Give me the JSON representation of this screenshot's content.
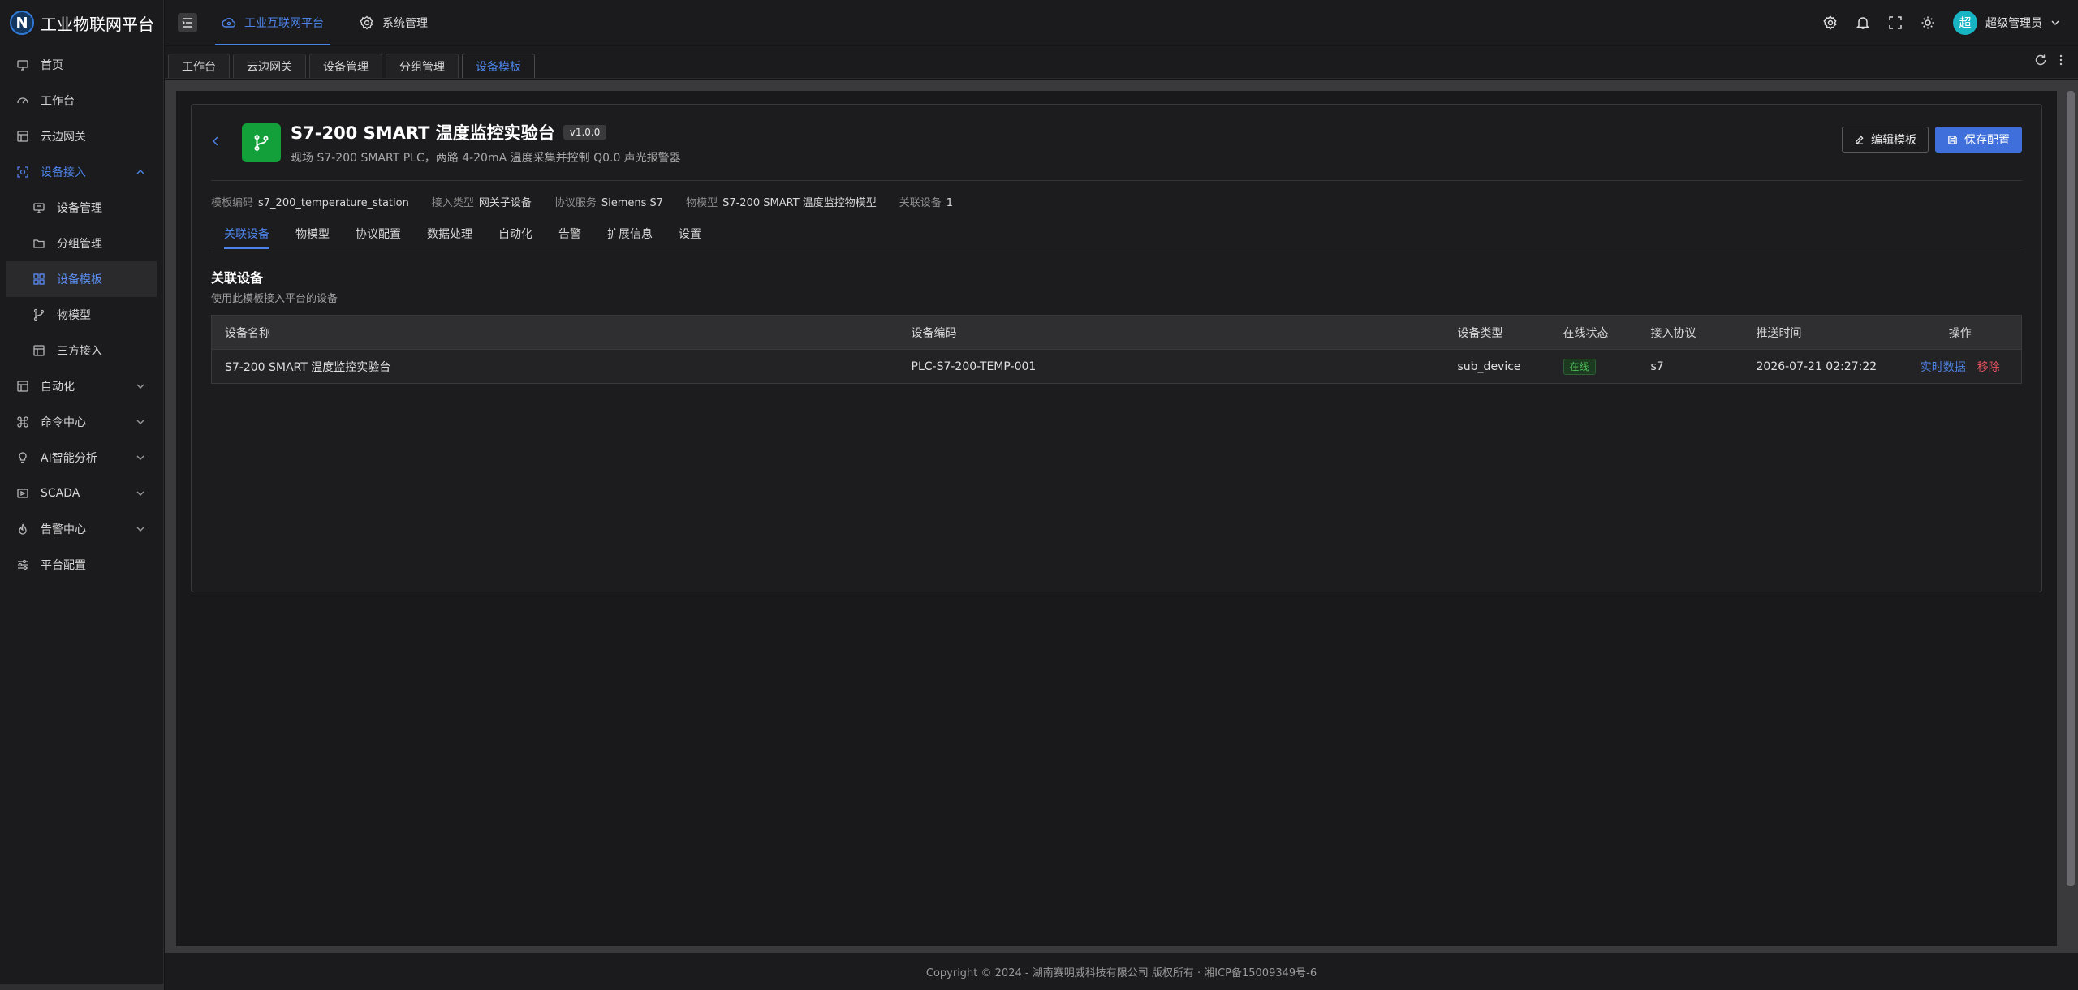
{
  "logo": {
    "mark": "N",
    "title": "工业物联网平台"
  },
  "sidebar": {
    "items": [
      {
        "label": "首页"
      },
      {
        "label": "工作台"
      },
      {
        "label": "云边网关"
      },
      {
        "label": "设备接入"
      },
      {
        "label": "设备管理"
      },
      {
        "label": "分组管理"
      },
      {
        "label": "设备模板"
      },
      {
        "label": "物模型"
      },
      {
        "label": "三方接入"
      },
      {
        "label": "自动化"
      },
      {
        "label": "命令中心"
      },
      {
        "label": "AI智能分析"
      },
      {
        "label": "SCADA"
      },
      {
        "label": "告警中心"
      },
      {
        "label": "平台配置"
      }
    ]
  },
  "header": {
    "tabs": [
      {
        "label": "工业互联网平台"
      },
      {
        "label": "系统管理"
      }
    ],
    "avatar": "超",
    "user": "超级管理员"
  },
  "page_tabs": [
    {
      "label": "工作台"
    },
    {
      "label": "云边网关"
    },
    {
      "label": "设备管理"
    },
    {
      "label": "分组管理"
    },
    {
      "label": "设备模板"
    }
  ],
  "template": {
    "name": "S7-200 SMART 温度监控实验台",
    "version": "v1.0.0",
    "desc": "现场 S7-200 SMART PLC，两路 4-20mA 温度采集并控制 Q0.0 声光报警器",
    "edit_label": "编辑模板",
    "save_label": "保存配置",
    "meta": [
      {
        "k": "模板编码",
        "v": "s7_200_temperature_station"
      },
      {
        "k": "接入类型",
        "v": "网关子设备"
      },
      {
        "k": "协议服务",
        "v": "Siemens S7"
      },
      {
        "k": "物模型",
        "v": "S7-200 SMART 温度监控物模型"
      },
      {
        "k": "关联设备",
        "v": "1"
      }
    ],
    "subtabs": [
      {
        "label": "关联设备"
      },
      {
        "label": "物模型"
      },
      {
        "label": "协议配置"
      },
      {
        "label": "数据处理"
      },
      {
        "label": "自动化"
      },
      {
        "label": "告警"
      },
      {
        "label": "扩展信息"
      },
      {
        "label": "设置"
      }
    ]
  },
  "section": {
    "title": "关联设备",
    "subtitle": "使用此模板接入平台的设备"
  },
  "table": {
    "columns": [
      "设备名称",
      "设备编码",
      "设备类型",
      "在线状态",
      "接入协议",
      "推送时间",
      "操作"
    ],
    "rows": [
      {
        "name": "S7-200 SMART 温度监控实验台",
        "code": "PLC-S7-200-TEMP-001",
        "type": "sub_device",
        "status": "在线",
        "protocol": "s7",
        "time": "2026-07-21 02:27:22",
        "action1": "实时数据",
        "action2": "移除"
      }
    ]
  },
  "footer": "Copyright © 2024 - 湖南赛明威科技有限公司 版权所有 · 湘ICP备15009349号-6",
  "colors": {
    "accent": "#4c83e8",
    "danger": "#e0505a",
    "success": "#4fc15a",
    "template_icon": "#13a03a"
  }
}
